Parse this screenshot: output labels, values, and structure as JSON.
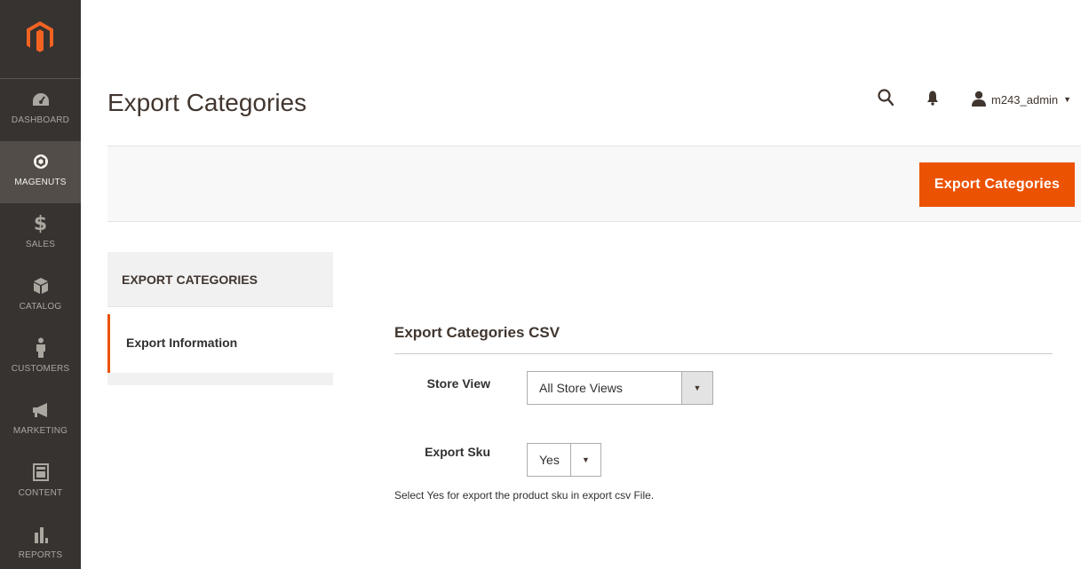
{
  "nav": [
    {
      "label": "DASHBOARD",
      "icon": "dashboard-icon"
    },
    {
      "label": "MAGENUTS",
      "icon": "magenuts-icon"
    },
    {
      "label": "SALES",
      "icon": "dollar-icon"
    },
    {
      "label": "CATALOG",
      "icon": "box-icon"
    },
    {
      "label": "CUSTOMERS",
      "icon": "person-icon"
    },
    {
      "label": "MARKETING",
      "icon": "megaphone-icon"
    },
    {
      "label": "CONTENT",
      "icon": "layout-icon"
    },
    {
      "label": "REPORTS",
      "icon": "bar-chart-icon"
    }
  ],
  "header": {
    "title": "Export Categories",
    "user": "m243_admin"
  },
  "actions": {
    "primary_label": "Export Categories"
  },
  "tabs": {
    "title": "EXPORT CATEGORIES",
    "items": [
      {
        "label": "Export Information"
      }
    ]
  },
  "form": {
    "fieldset_title": "Export Categories CSV",
    "store_view": {
      "label": "Store View",
      "value": "All Store Views"
    },
    "export_sku": {
      "label": "Export Sku",
      "value": "Yes",
      "note": "Select Yes for export the product sku in export csv File."
    }
  },
  "colors": {
    "accent": "#eb5202",
    "sidebar": "#373330",
    "sidebar_active": "#524d49"
  }
}
